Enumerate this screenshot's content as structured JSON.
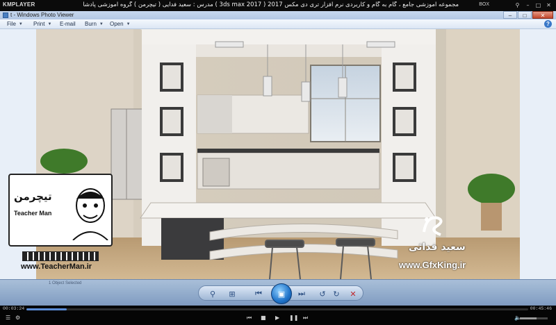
{
  "player": {
    "logo": "KMPLAYER",
    "title": "مجموعه آموزشی جامع ، گام به گام و کاربردی نرم افزار تری دی مکس 2017 ( 3ds max 2017 )  مدرس : سعید فدایی ( تیچرمن ) گروه آموزشی پادشاه گرافیست ها",
    "box_label": "BOX",
    "time_elapsed": "00:03:24",
    "time_total": "00:45:46",
    "progress": 0.08,
    "volume": 0.6
  },
  "window": {
    "title": "t - Windows Photo Viewer",
    "menu": [
      {
        "label": "File"
      },
      {
        "label": "Print"
      },
      {
        "label": "E-mail"
      },
      {
        "label": "Burn"
      },
      {
        "label": "Open"
      }
    ],
    "toolbar_ghost": "1 Object Selected"
  },
  "overlays": {
    "teacherman_site": "www.TeacherMan.ir",
    "teacherman_logo_text": "تیچرمن",
    "teacherman_name": "Teacher Man",
    "gfxking_name": "سعید فدائی",
    "gfxking_site": "www.GfxKing.ir"
  },
  "icons": {
    "zoom": "zoom-icon",
    "fit": "actual-size-icon",
    "prev": "previous-icon",
    "slideshow": "slideshow-icon",
    "next": "next-icon",
    "rotate_ccw": "rotate-counterclockwise-icon",
    "rotate_cw": "rotate-clockwise-icon",
    "delete": "delete-icon"
  }
}
